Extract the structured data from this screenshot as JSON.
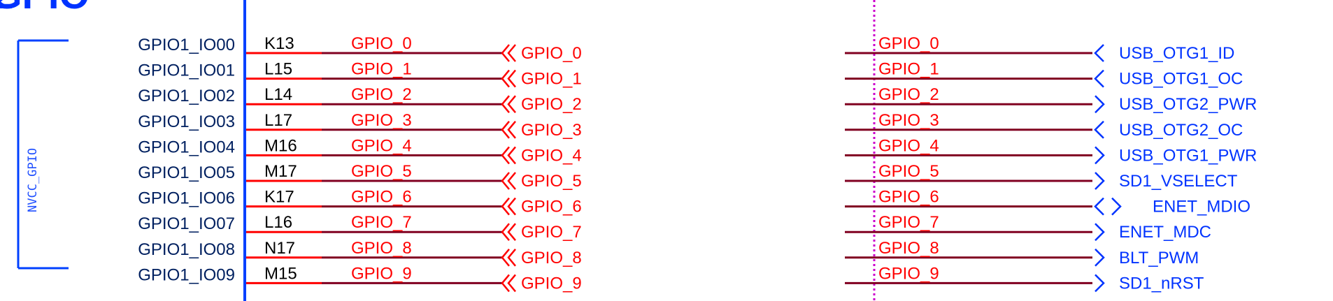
{
  "title": "GPIO",
  "power_label": "NVCC_GPIO",
  "colors": {
    "wire": "#800020",
    "pin_stub": "#ff0000",
    "net_label": "#ff0000",
    "pin_name": "#002060",
    "ball": "#000000",
    "body": "#0040ff",
    "port_blue": "#0033ff",
    "divider": "#cc00cc"
  },
  "pins": [
    {
      "name": "GPIO1_IO00",
      "ball": "K13",
      "net": "GPIO_0"
    },
    {
      "name": "GPIO1_IO01",
      "ball": "L15",
      "net": "GPIO_1"
    },
    {
      "name": "GPIO1_IO02",
      "ball": "L14",
      "net": "GPIO_2"
    },
    {
      "name": "GPIO1_IO03",
      "ball": "L17",
      "net": "GPIO_3"
    },
    {
      "name": "GPIO1_IO04",
      "ball": "M16",
      "net": "GPIO_4"
    },
    {
      "name": "GPIO1_IO05",
      "ball": "M17",
      "net": "GPIO_5"
    },
    {
      "name": "GPIO1_IO06",
      "ball": "K17",
      "net": "GPIO_6"
    },
    {
      "name": "GPIO1_IO07",
      "ball": "L16",
      "net": "GPIO_7"
    },
    {
      "name": "GPIO1_IO08",
      "ball": "N17",
      "net": "GPIO_8"
    },
    {
      "name": "GPIO1_IO09",
      "ball": "M15",
      "net": "GPIO_9"
    }
  ],
  "left_ports": [
    "GPIO_0",
    "GPIO_1",
    "GPIO_2",
    "GPIO_3",
    "GPIO_4",
    "GPIO_5",
    "GPIO_6",
    "GPIO_7",
    "GPIO_8",
    "GPIO_9"
  ],
  "right_nets": [
    {
      "net": "GPIO_0",
      "port": "USB_OTG1_ID",
      "dir": "in"
    },
    {
      "net": "GPIO_1",
      "port": "USB_OTG1_OC",
      "dir": "in"
    },
    {
      "net": "GPIO_2",
      "port": "USB_OTG2_PWR",
      "dir": "out"
    },
    {
      "net": "GPIO_3",
      "port": "USB_OTG2_OC",
      "dir": "in"
    },
    {
      "net": "GPIO_4",
      "port": "USB_OTG1_PWR",
      "dir": "out"
    },
    {
      "net": "GPIO_5",
      "port": "SD1_VSELECT",
      "dir": "out"
    },
    {
      "net": "GPIO_6",
      "port": "ENET_MDIO",
      "dir": "bidir"
    },
    {
      "net": "GPIO_7",
      "port": "ENET_MDC",
      "dir": "out"
    },
    {
      "net": "GPIO_8",
      "port": "BLT_PWM",
      "dir": "out"
    },
    {
      "net": "GPIO_9",
      "port": "SD1_nRST",
      "dir": "out"
    }
  ]
}
